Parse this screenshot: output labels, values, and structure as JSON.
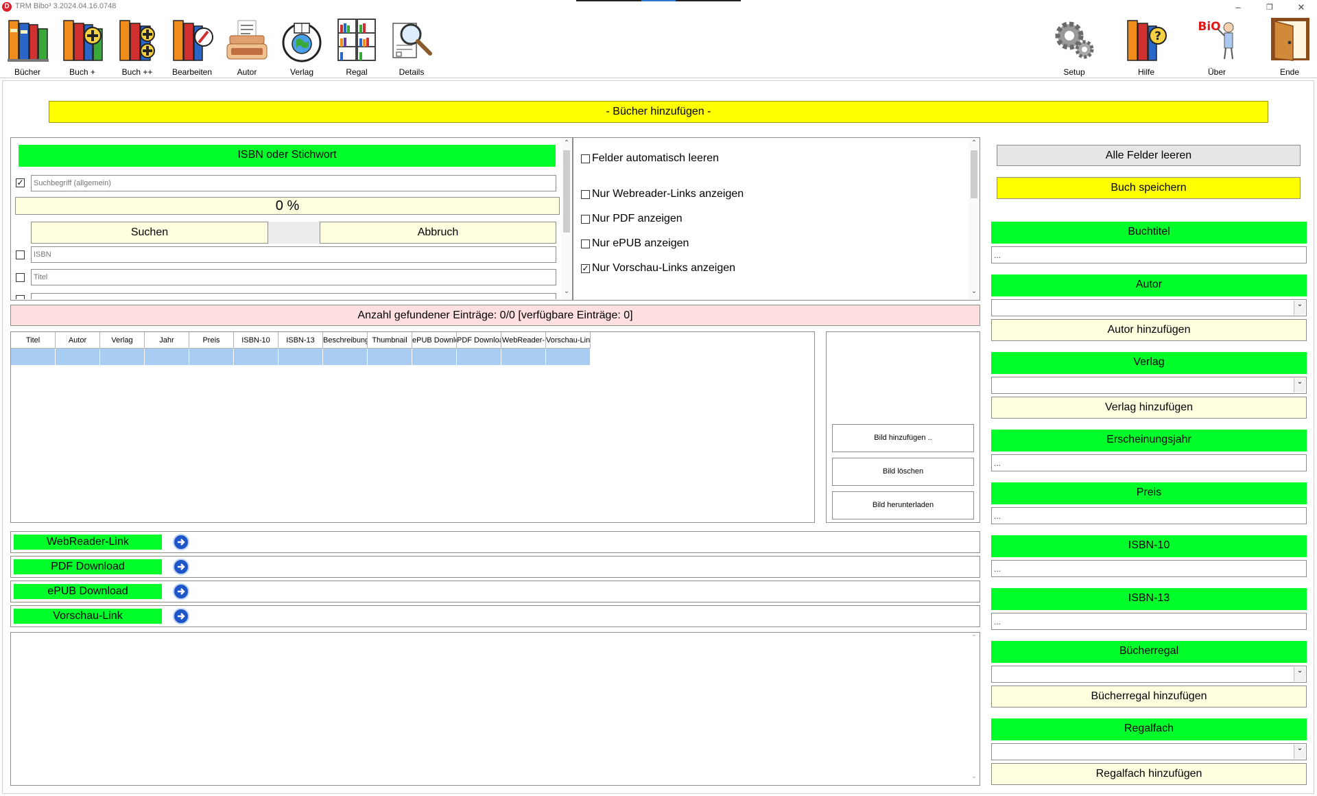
{
  "window": {
    "title": "TRM Bibo³ 3.2024.04.16.0748",
    "logo_letter": "D",
    "minimize_glyph": "–",
    "restore_glyph": "❐",
    "close_glyph": "✕"
  },
  "toolbar": {
    "left": [
      {
        "label": "Bücher"
      },
      {
        "label": "Buch +"
      },
      {
        "label": "Buch ++"
      },
      {
        "label": "Bearbeiten"
      },
      {
        "label": "Autor"
      },
      {
        "label": "Verlag"
      },
      {
        "label": "Regal"
      },
      {
        "label": "Details"
      }
    ],
    "right": [
      {
        "label": "Setup"
      },
      {
        "label": "Hilfe"
      },
      {
        "label": "Über",
        "logo_text": "BiO"
      },
      {
        "label": "Ende"
      }
    ]
  },
  "banner": "- Bücher hinzufügen -",
  "search": {
    "header": "ISBN oder Stichwort",
    "general_checked": true,
    "general_placeholder": "Suchbegriff (allgemein)",
    "progress": "0 %",
    "search_button": "Suchen",
    "cancel_button": "Abbruch",
    "isbn_placeholder": "ISBN",
    "title_placeholder": "Titel"
  },
  "options": [
    {
      "label": "Felder automatisch leeren",
      "checked": false
    },
    {
      "label": "Nur Webreader-Links anzeigen",
      "checked": false
    },
    {
      "label": "Nur PDF anzeigen",
      "checked": false
    },
    {
      "label": "Nur ePUB anzeigen",
      "checked": false
    },
    {
      "label": "Nur Vorschau-Links anzeigen",
      "checked": true
    }
  ],
  "count_text": "Anzahl gefundener Einträge: 0/0 [verfügbare Einträge: 0]",
  "grid": {
    "columns": [
      "Titel",
      "Autor",
      "Verlag",
      "Jahr",
      "Preis",
      "ISBN-10",
      "ISBN-13",
      "Beschreibung",
      "Thumbnail",
      "ePUB Downlo",
      "PDF Downloa",
      "WebReader-",
      "Vorschau-Lin"
    ]
  },
  "image_buttons": {
    "add": "Bild hinzufügen ..",
    "delete": "Bild löschen",
    "download": "Bild herunterladen"
  },
  "links": [
    {
      "label": "WebReader-Link"
    },
    {
      "label": "PDF Download"
    },
    {
      "label": "ePUB Download"
    },
    {
      "label": "Vorschau-Link"
    }
  ],
  "right_panel": {
    "clear_all": "Alle Felder leeren",
    "save_book": "Buch speichern",
    "book_title": {
      "label": "Buchtitel",
      "value": "..."
    },
    "author": {
      "label": "Autor",
      "add": "Autor hinzufügen"
    },
    "publisher": {
      "label": "Verlag",
      "add": "Verlag hinzufügen"
    },
    "year": {
      "label": "Erscheinungsjahr",
      "value": "..."
    },
    "price": {
      "label": "Preis",
      "value": "..."
    },
    "isbn10": {
      "label": "ISBN-10",
      "value": "..."
    },
    "isbn13": {
      "label": "ISBN-13",
      "value": "..."
    },
    "shelf": {
      "label": "Bücherregal",
      "add": "Bücherregal hinzufügen"
    },
    "compartment": {
      "label": "Regalfach",
      "add": "Regalfach hinzufügen"
    }
  },
  "colors": {
    "accent_green": "#00ff2a",
    "banner_yellow": "#ffff00",
    "cream": "#ffffe0",
    "count_bar": "#ffe0e0",
    "grid_selection": "#a9cdf2"
  }
}
